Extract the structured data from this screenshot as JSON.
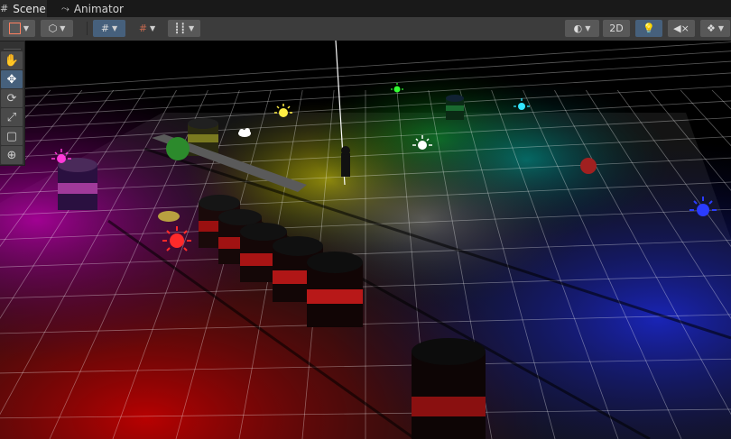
{
  "tabs": [
    {
      "label": "Scene",
      "icon": "scene-icon",
      "active": true
    },
    {
      "label": "Animator",
      "icon": "animator-icon",
      "active": false
    }
  ],
  "toolbar": {
    "mode_2d_label": "2D",
    "lighting_on": true
  },
  "tool_palette": [
    {
      "name": "hand-tool",
      "icon": "hand-icon",
      "active": false
    },
    {
      "name": "move-tool",
      "icon": "move-arrows-icon",
      "active": true
    },
    {
      "name": "rotate-tool",
      "icon": "rotate-icon",
      "active": false
    },
    {
      "name": "scale-tool",
      "icon": "scale-icon",
      "active": false
    },
    {
      "name": "rect-tool",
      "icon": "rect-icon",
      "active": false
    },
    {
      "name": "transform-tool",
      "icon": "transform-icon",
      "active": false
    }
  ],
  "colors": {
    "red_light": "#ff2a2a",
    "magenta_light": "#ff3ad8",
    "yellow_light": "#ffee44",
    "green_light": "#33ff33",
    "cyan_light": "#33e6ff",
    "blue_light": "#2a3cff",
    "white_light": "#ffffff"
  }
}
